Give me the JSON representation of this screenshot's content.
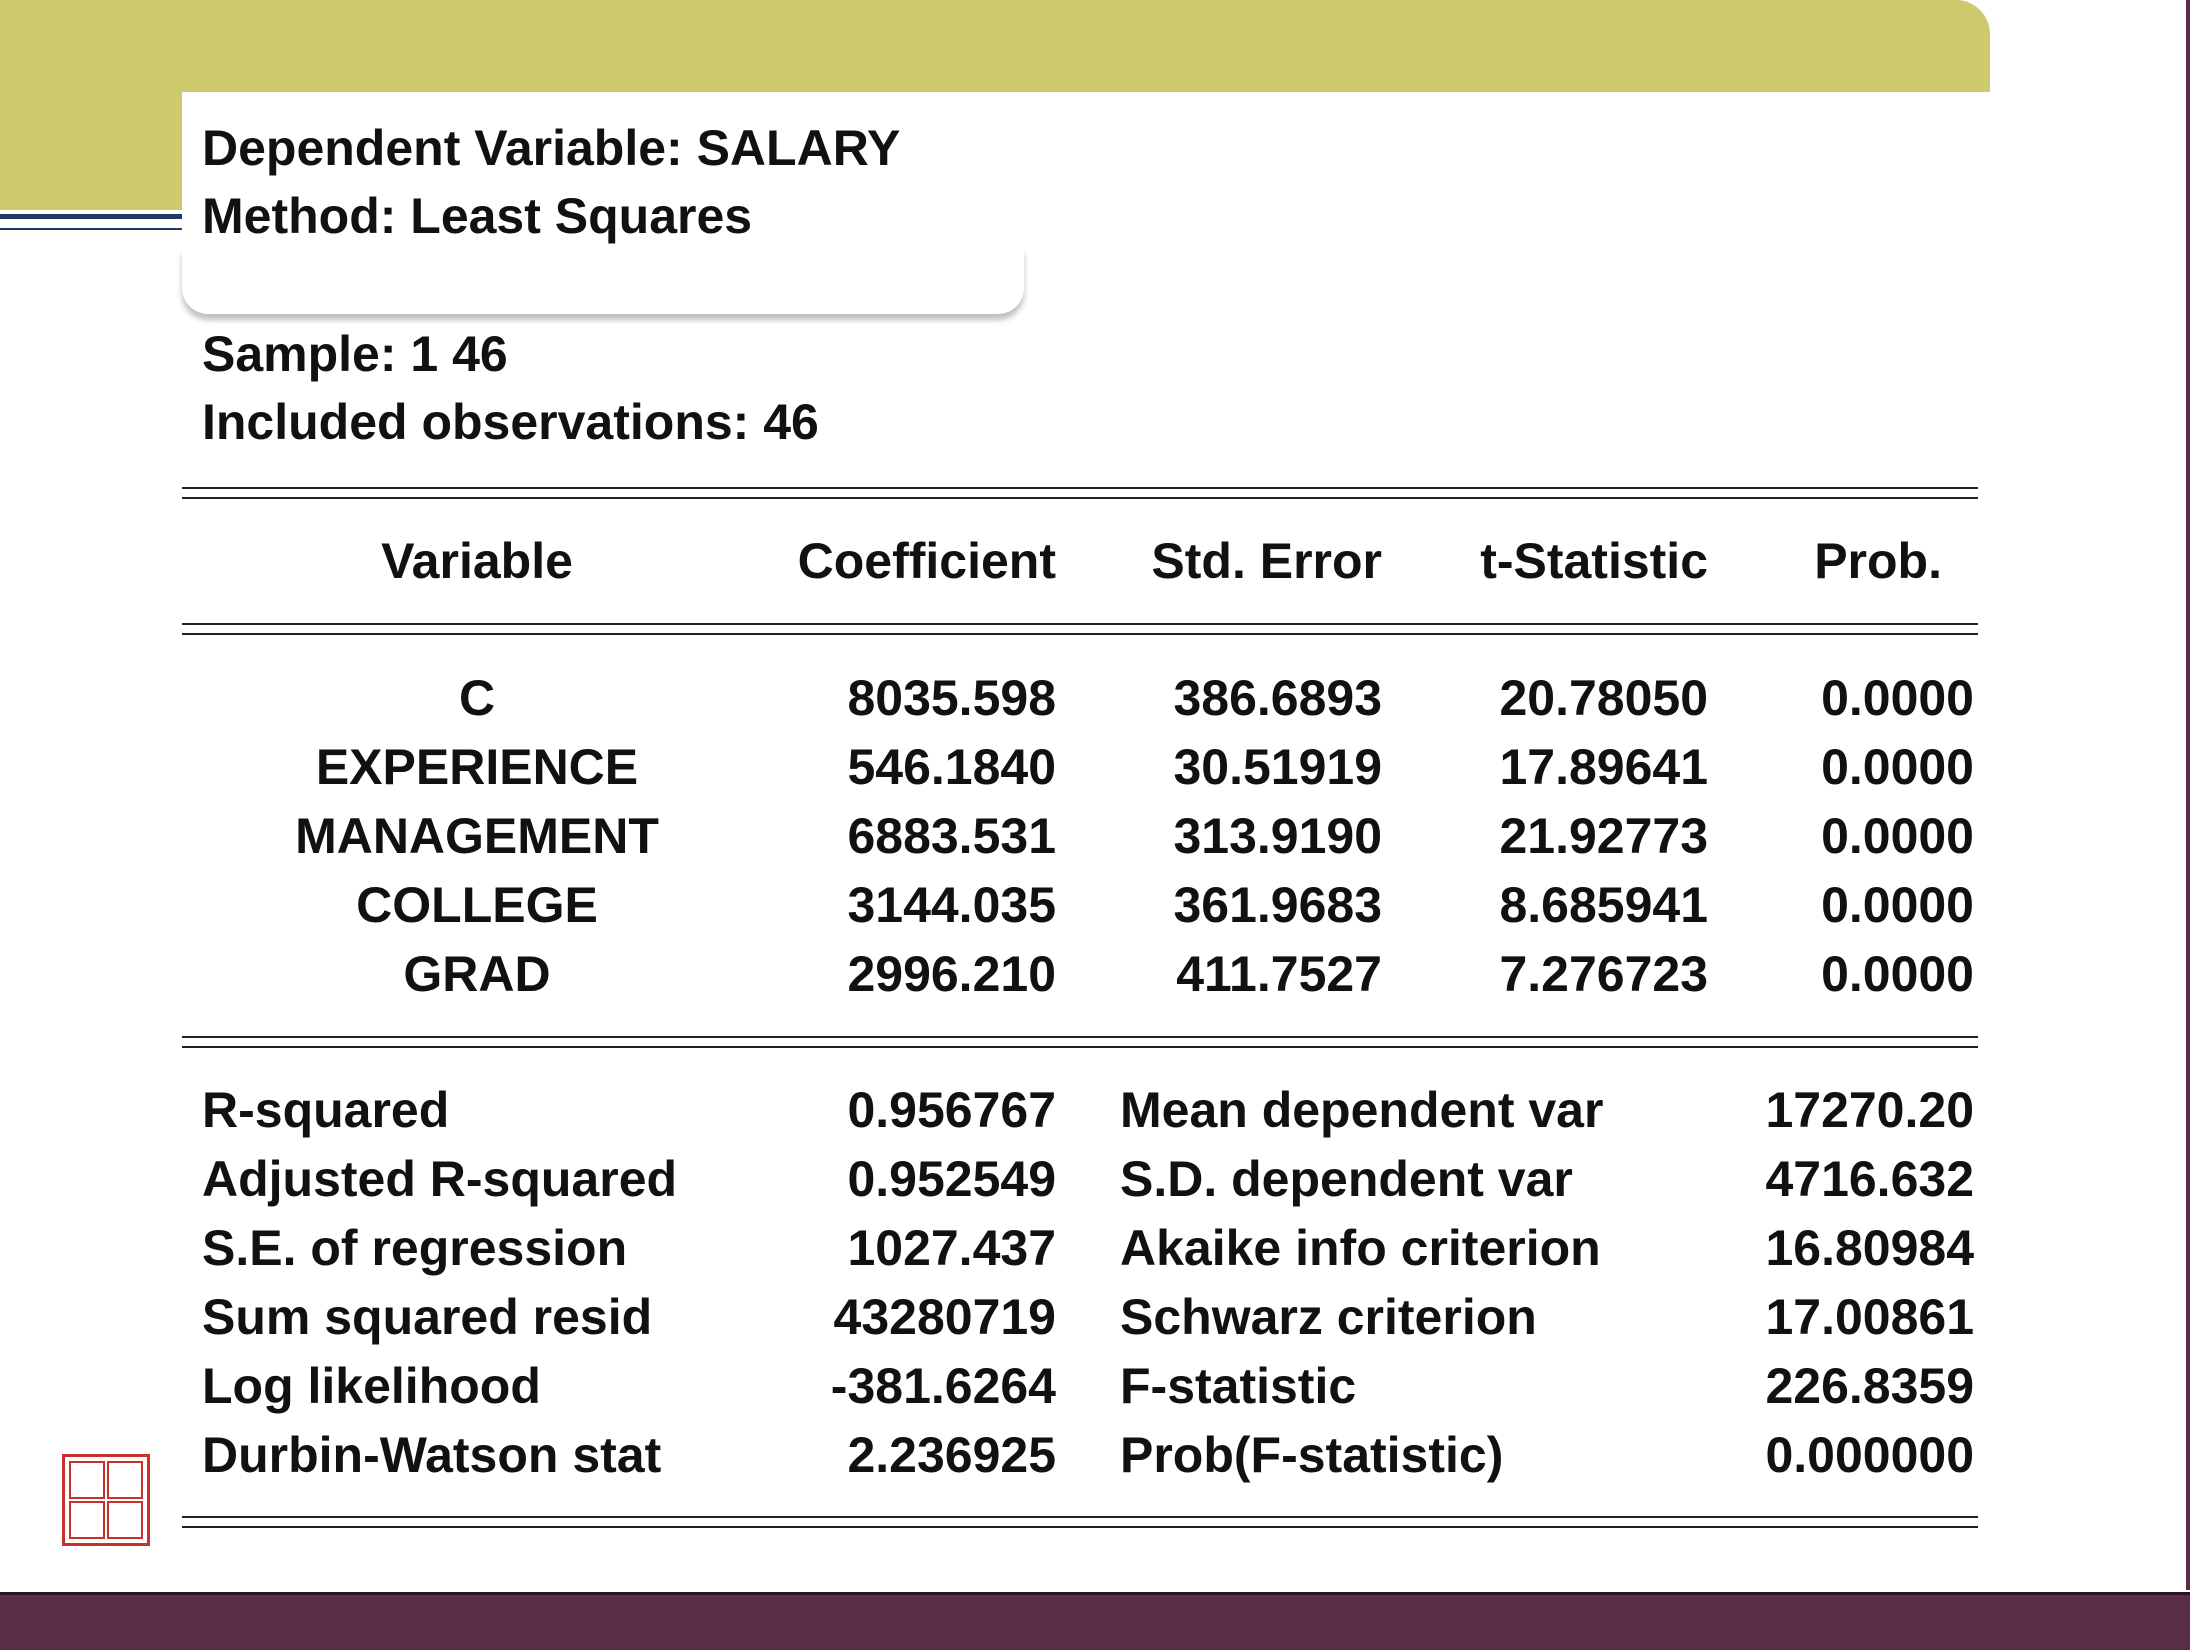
{
  "header": {
    "dependent_variable": "Dependent Variable: SALARY",
    "method": "Method: Least Squares",
    "sample": "Sample: 1 46",
    "included_observations": "Included observations: 46"
  },
  "coef_table": {
    "columns": [
      "Variable",
      "Coefficient",
      "Std. Error",
      "t-Statistic",
      "Prob."
    ],
    "rows": [
      [
        "C",
        "8035.598",
        "386.6893",
        "20.78050",
        "0.0000"
      ],
      [
        "EXPERIENCE",
        "546.1840",
        "30.51919",
        "17.89641",
        "0.0000"
      ],
      [
        "MANAGEMENT",
        "6883.531",
        "313.9190",
        "21.92773",
        "0.0000"
      ],
      [
        "COLLEGE",
        "3144.035",
        "361.9683",
        "8.685941",
        "0.0000"
      ],
      [
        "GRAD",
        "2996.210",
        "411.7527",
        "7.276723",
        "0.0000"
      ]
    ]
  },
  "stats_table": {
    "rows": [
      [
        "R-squared",
        "0.956767",
        "Mean dependent var",
        "17270.20"
      ],
      [
        "Adjusted R-squared",
        "0.952549",
        "S.D. dependent var",
        "4716.632"
      ],
      [
        "S.E. of regression",
        "1027.437",
        "Akaike info criterion",
        "16.80984"
      ],
      [
        "Sum squared resid",
        "43280719",
        "Schwarz criterion",
        "17.00861"
      ],
      [
        "Log likelihood",
        "-381.6264",
        "F-statistic",
        "226.8359"
      ],
      [
        "Durbin-Watson stat",
        "2.236925",
        "Prob(F-statistic)",
        "0.000000"
      ]
    ]
  },
  "colors": {
    "top_band": "#cfc96e",
    "bottom_bar": "#5b2c48",
    "rule": "#1f3b64",
    "seal": "#c8322b"
  },
  "icons": {
    "seal": "red-seal-stamp-icon"
  }
}
